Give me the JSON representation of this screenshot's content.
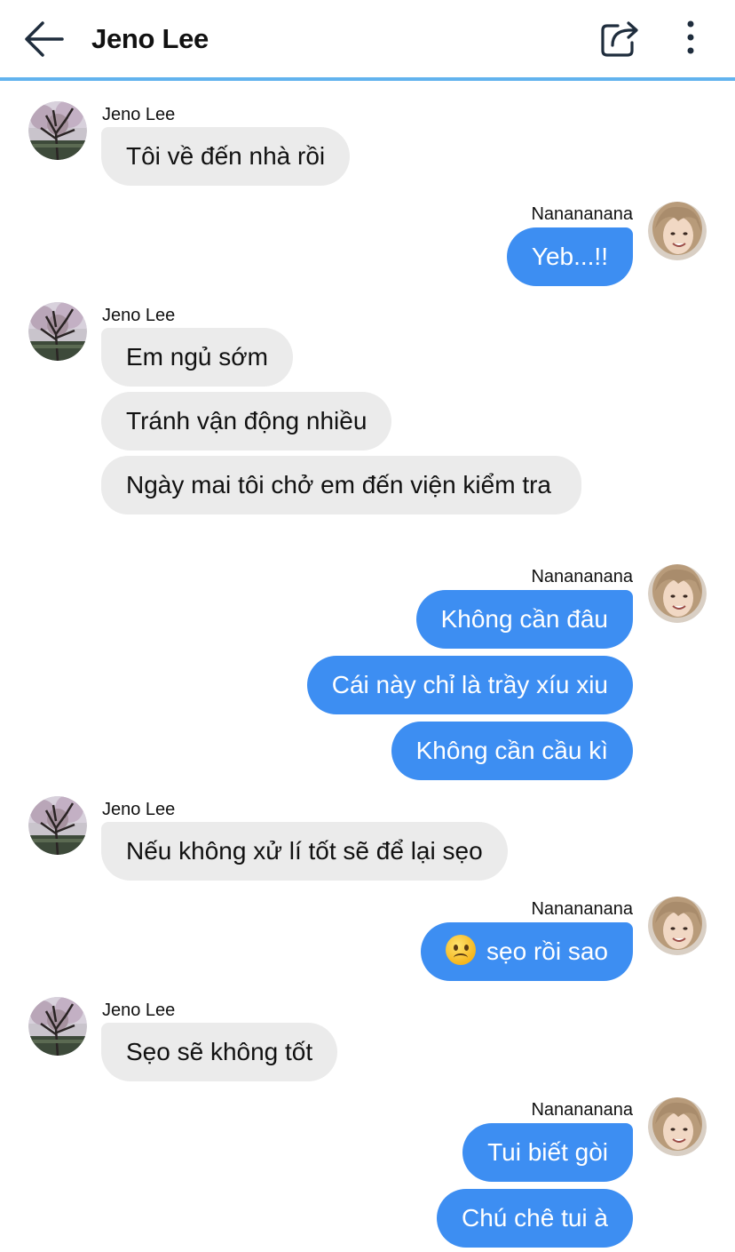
{
  "header": {
    "title": "Jeno Lee",
    "back_icon": "arrow-left-icon",
    "share_icon": "share-icon",
    "more_icon": "more-vertical-icon",
    "accent_color": "#62b3ee"
  },
  "colors": {
    "incoming_bubble": "#ebebeb",
    "outgoing_bubble": "#3d8ef2"
  },
  "messages": [
    {
      "sender": "Jeno Lee",
      "direction": "incoming",
      "texts": [
        "Tôi về đến nhà rồi"
      ]
    },
    {
      "sender": "Nanananana",
      "direction": "outgoing",
      "texts": [
        "Yeb...!!"
      ]
    },
    {
      "sender": "Jeno Lee",
      "direction": "incoming",
      "texts": [
        "Em ngủ sớm",
        "Tránh vận động nhiều",
        "Ngày mai tôi chở em đến viện kiểm tra"
      ]
    },
    {
      "sender": "Nanananana",
      "direction": "outgoing",
      "texts": [
        "Không cần đâu",
        "Cái này chỉ là trầy xíu xiu",
        "Không cần cầu kì"
      ]
    },
    {
      "sender": "Jeno Lee",
      "direction": "incoming",
      "texts": [
        "Nếu không xử lí tốt sẽ để lại sẹo"
      ]
    },
    {
      "sender": "Nanananana",
      "direction": "outgoing",
      "emoji": "slightly-frowning-face-emoji",
      "texts": [
        "sẹo rồi sao"
      ]
    },
    {
      "sender": "Jeno Lee",
      "direction": "incoming",
      "texts": [
        "Sẹo sẽ không tốt"
      ]
    },
    {
      "sender": "Nanananana",
      "direction": "outgoing",
      "texts": [
        "Tui biết gòi",
        "Chú chê tui à"
      ]
    }
  ]
}
